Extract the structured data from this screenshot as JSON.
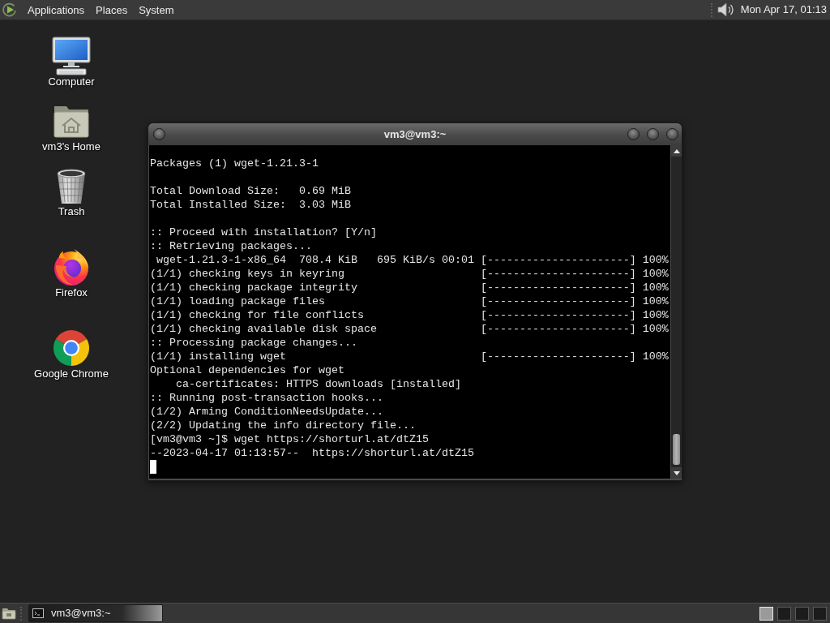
{
  "top_panel": {
    "menus": [
      "Applications",
      "Places",
      "System"
    ],
    "clock": "Mon Apr 17, 01:13"
  },
  "desktop_icons": [
    {
      "kind": "computer",
      "label": "Computer"
    },
    {
      "kind": "home",
      "label": "vm3's Home"
    },
    {
      "kind": "trash",
      "label": "Trash"
    },
    {
      "kind": "firefox",
      "label": "Firefox"
    },
    {
      "kind": "chrome",
      "label": "Google Chrome"
    }
  ],
  "terminal": {
    "title": "vm3@vm3:~",
    "blocks": [
      [
        {
          "kind": "text",
          "text": "Packages (1) wget-1.21.3-1"
        }
      ],
      [
        {
          "kind": "text",
          "text": "Total Download Size:   0.69 MiB"
        },
        {
          "kind": "text",
          "text": "Total Installed Size:  3.03 MiB"
        }
      ],
      [
        {
          "kind": "text",
          "text": ":: Proceed with installation? [Y/n]"
        },
        {
          "kind": "text",
          "text": ":: Retrieving packages..."
        },
        {
          "kind": "progress",
          "label": " wget-1.21.3-1-x86_64  708.4 KiB   695 KiB/s 00:01",
          "bar": "[----------------------]",
          "percent": "100%"
        },
        {
          "kind": "progress",
          "label": "(1/1) checking keys in keyring",
          "bar": "[----------------------]",
          "percent": "100%"
        },
        {
          "kind": "progress",
          "label": "(1/1) checking package integrity",
          "bar": "[----------------------]",
          "percent": "100%"
        },
        {
          "kind": "progress",
          "label": "(1/1) loading package files",
          "bar": "[----------------------]",
          "percent": "100%"
        },
        {
          "kind": "progress",
          "label": "(1/1) checking for file conflicts",
          "bar": "[----------------------]",
          "percent": "100%"
        },
        {
          "kind": "progress",
          "label": "(1/1) checking available disk space",
          "bar": "[----------------------]",
          "percent": "100%"
        },
        {
          "kind": "text",
          "text": ":: Processing package changes..."
        },
        {
          "kind": "progress",
          "label": "(1/1) installing wget",
          "bar": "[----------------------]",
          "percent": "100%"
        },
        {
          "kind": "text",
          "text": "Optional dependencies for wget"
        },
        {
          "kind": "text",
          "text": "    ca-certificates: HTTPS downloads [installed]"
        },
        {
          "kind": "text",
          "text": ":: Running post-transaction hooks..."
        },
        {
          "kind": "text",
          "text": "(1/2) Arming ConditionNeedsUpdate..."
        },
        {
          "kind": "text",
          "text": "(2/2) Updating the info directory file..."
        },
        {
          "kind": "text",
          "text": "[vm3@vm3 ~]$ wget https://shorturl.at/dtZ15"
        },
        {
          "kind": "text",
          "text": "--2023-04-17 01:13:57--  https://shorturl.at/dtZ15"
        }
      ]
    ]
  },
  "taskbar": {
    "tasks": [
      {
        "label": "vm3@vm3:~",
        "selected": true
      }
    ],
    "workspaces": [
      {
        "selected": true
      },
      {
        "selected": false
      },
      {
        "selected": false
      },
      {
        "selected": false
      }
    ]
  }
}
